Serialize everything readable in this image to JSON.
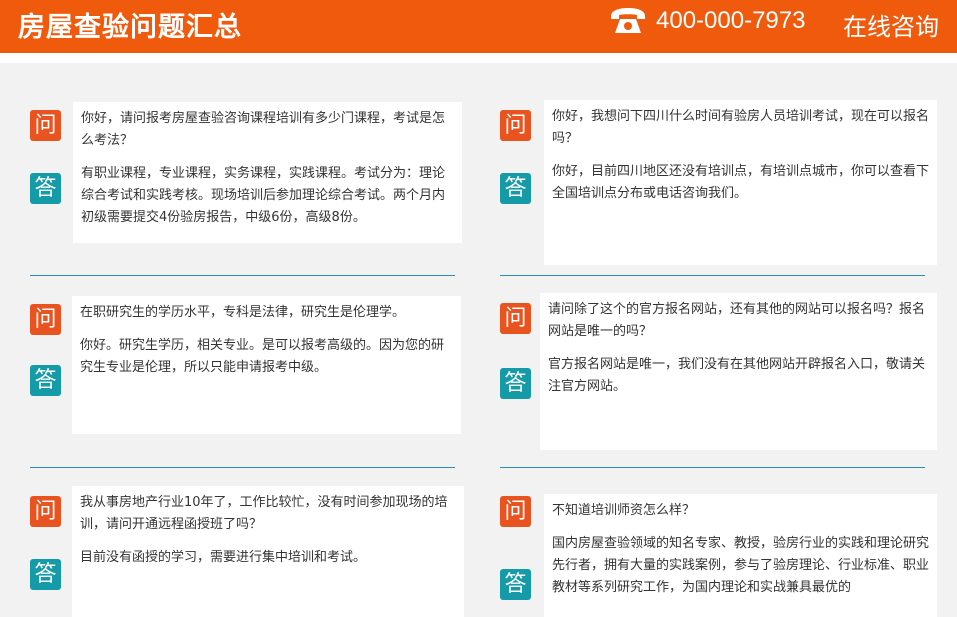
{
  "header": {
    "title": "房屋查验问题汇总",
    "phone": "400-000-7973",
    "consult": "在线咨询"
  },
  "labels": {
    "q": "问",
    "a": "答"
  },
  "qa": [
    {
      "question": "你好，请问报考房屋查验咨询课程培训有多少门课程，考试是怎么考法？",
      "answer": "有职业课程，专业课程，实务课程，实践课程。考试分为：理论综合考试和实践考核。现场培训后参加理论综合考试。两个月内初级需要提交4份验房报告，中级6份，高级8份。"
    },
    {
      "question": "你好，我想问下四川什么时间有验房人员培训考试，现在可以报名吗？",
      "answer": "你好，目前四川地区还没有培训点，有培训点城市，你可以查看下全国培训点分布或电话咨询我们。"
    },
    {
      "question": "在职研究生的学历水平，专科是法律，研究生是伦理学。",
      "answer": "你好。研究生学历，相关专业。是可以报考高级的。因为您的研究生专业是伦理，所以只能申请报考中级。"
    },
    {
      "question": "请问除了这个的官方报名网站，还有其他的网站可以报名吗？报名网站是唯一的吗？",
      "answer": "官方报名网站是唯一，我们没有在其他网站开辟报名入口，敬请关注官方网站。"
    },
    {
      "question": "我从事房地产行业10年了，工作比较忙，没有时间参加现场的培训，请问开通远程函授班了吗？",
      "answer": "目前没有函授的学习，需要进行集中培训和考试。"
    },
    {
      "question": "不知道培训师资怎么样？",
      "answer": "国内房屋查验领域的知名专家、教授，验房行业的实践和理论研究先行者，拥有大量的实践案例，参与了验房理论、行业标准、职业教材等系列研究工作，为国内理论和实战兼具最优的"
    }
  ]
}
